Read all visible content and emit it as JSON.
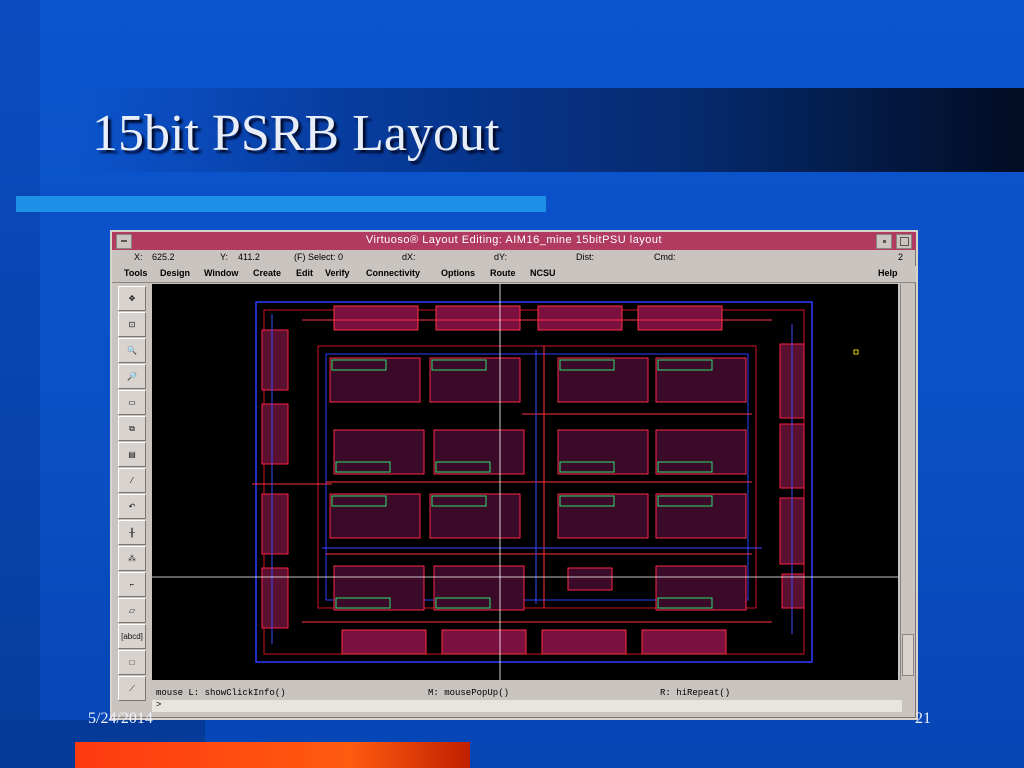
{
  "slide": {
    "title": "15bit PSRB Layout",
    "date": "5/24/2014",
    "page_number": "21"
  },
  "window": {
    "title": "Virtuoso® Layout Editing: AIM16_mine 15bitPSU layout",
    "status": {
      "x_label": "X:",
      "x_value": "625.2",
      "y_label": "Y:",
      "y_value": "411.2",
      "select": "(F) Select: 0",
      "dx": "dX:",
      "dy": "dY:",
      "dist": "Dist:",
      "cmd": "Cmd:",
      "count": "2"
    },
    "menu": [
      "Tools",
      "Design",
      "Window",
      "Create",
      "Edit",
      "Verify",
      "Connectivity",
      "Options",
      "Route",
      "NCSU"
    ],
    "help": "Help",
    "tools": [
      {
        "name": "save-icon",
        "glyph": "✥"
      },
      {
        "name": "zoom-fit-icon",
        "glyph": "⊡"
      },
      {
        "name": "zoom-in-icon",
        "glyph": "🔍"
      },
      {
        "name": "zoom-out-icon",
        "glyph": "🔎"
      },
      {
        "name": "stretch-icon",
        "glyph": "▭"
      },
      {
        "name": "copy-icon",
        "glyph": "⧉"
      },
      {
        "name": "move-icon",
        "glyph": "▤"
      },
      {
        "name": "delete-icon",
        "glyph": "⁄"
      },
      {
        "name": "undo-icon",
        "glyph": "↶"
      },
      {
        "name": "property-icon",
        "glyph": "╫"
      },
      {
        "name": "instance-icon",
        "glyph": "⁂"
      },
      {
        "name": "path-icon",
        "glyph": "⌐"
      },
      {
        "name": "polygon-icon",
        "glyph": "▱"
      },
      {
        "name": "label-icon",
        "glyph": "[abcd]"
      },
      {
        "name": "rectangle-icon",
        "glyph": "□"
      },
      {
        "name": "ruler-icon",
        "glyph": "⟋"
      }
    ],
    "mouse": {
      "left": "mouse L: showClickInfo()",
      "middle": "M: mousePopUp()",
      "right": "R: hiRepeat()"
    },
    "prompt": ">"
  }
}
